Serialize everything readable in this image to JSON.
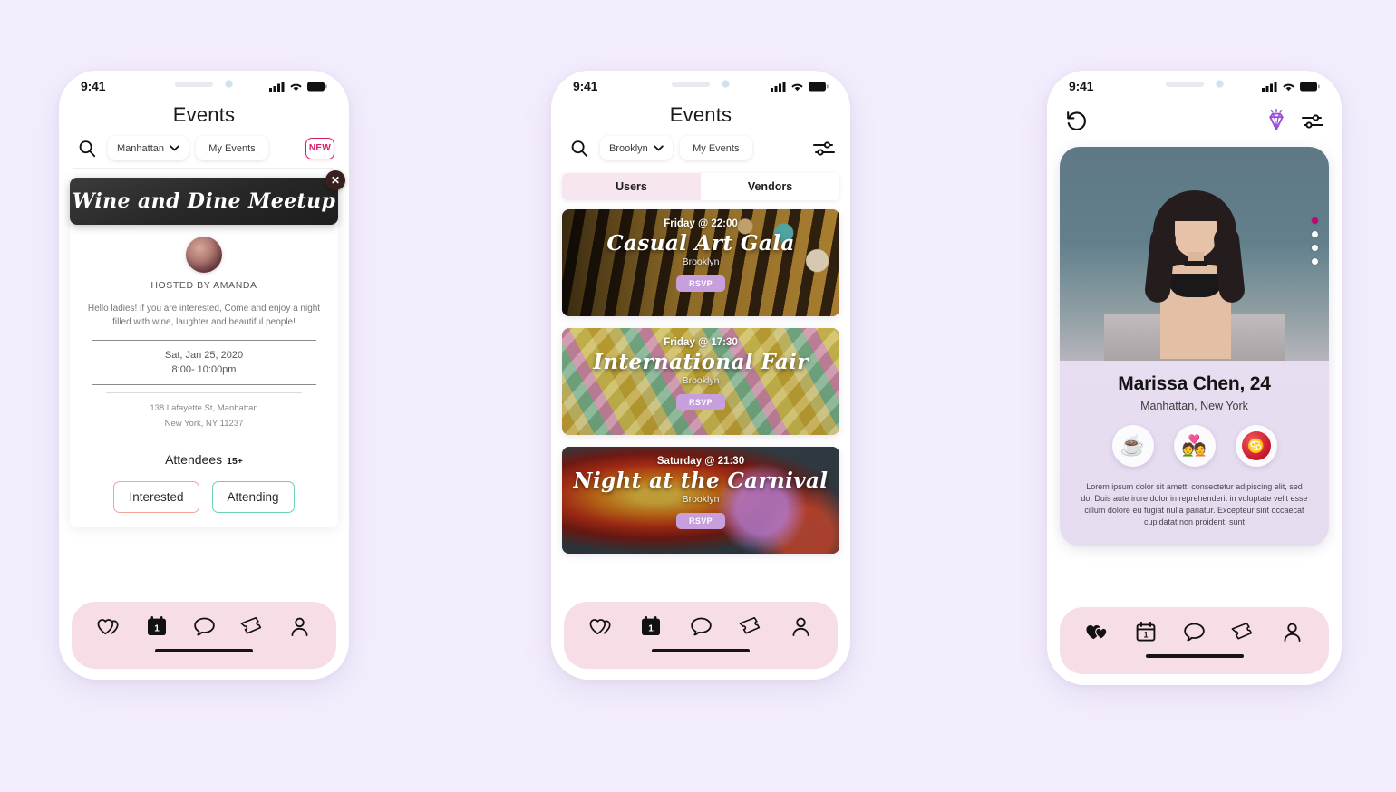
{
  "background_color": "#f3edfd",
  "accent": {
    "pink": "#d61f69",
    "nav_bg": "#f7dde5",
    "tab_active_bg": "#f7e6ef",
    "rsvp_bg": "#c79fdc",
    "gem_purple": "#9b4dd8",
    "dot_active": "#c4046b"
  },
  "phone1": {
    "status": {
      "time": "9:41",
      "cellular": "signal-bars-icon",
      "wifi": "wifi-icon",
      "battery": "battery-icon"
    },
    "title": "Events",
    "toolbar": {
      "search_icon": "search-icon",
      "location": "Manhattan",
      "location_chevron": "chevron-down-icon",
      "my_events": "My Events",
      "new_badge": "NEW"
    },
    "event": {
      "banner_title": "Wine and Dine Meetup",
      "close_icon": "close-icon",
      "avatar": "host-avatar",
      "host": "HOSTED BY AMANDA",
      "description": "Hello ladies! if you are interested, Come and enjoy a night filled with wine, laughter  and beautiful people!",
      "date": "Sat, Jan 25, 2020",
      "time": "8:00- 10:00pm",
      "address_line1": "138 Lafayette St, Manhattan",
      "address_line2": "New York, NY 11237",
      "attendees_label": "Attendees",
      "attendees_count": "15+",
      "btn_interested": "Interested",
      "btn_attending": "Attending"
    },
    "nav": [
      {
        "name": "hearts",
        "icon": "two-hearts-icon",
        "active": false
      },
      {
        "name": "calendar",
        "icon": "calendar-icon",
        "active": true,
        "badge": "1"
      },
      {
        "name": "chat",
        "icon": "chat-bubble-icon",
        "active": false
      },
      {
        "name": "tickets",
        "icon": "ticket-icon",
        "active": false
      },
      {
        "name": "profile",
        "icon": "person-icon",
        "active": false
      }
    ]
  },
  "phone2": {
    "status": {
      "time": "9:41"
    },
    "title": "Events",
    "toolbar": {
      "search_icon": "search-icon",
      "location": "Brooklyn",
      "location_chevron": "chevron-down-icon",
      "my_events": "My Events",
      "filter_icon": "sliders-icon"
    },
    "tabs": [
      {
        "label": "Users",
        "active": true
      },
      {
        "label": "Vendors",
        "active": false
      }
    ],
    "events": [
      {
        "time": "Friday @ 22:00",
        "title": "Casual Art Gala",
        "location": "Brooklyn",
        "rsvp": "RSVP",
        "bg": "bg-art"
      },
      {
        "time": "Friday @ 17:30",
        "title": "International Fair",
        "location": "Brooklyn",
        "rsvp": "RSVP",
        "bg": "bg-fair"
      },
      {
        "time": "Saturday @ 21:30",
        "title": "Night at the Carnival",
        "location": "Brooklyn",
        "rsvp": "RSVP",
        "bg": "bg-carn"
      }
    ],
    "nav": [
      {
        "name": "hearts",
        "icon": "two-hearts-icon",
        "active": false
      },
      {
        "name": "calendar",
        "icon": "calendar-icon",
        "active": true,
        "badge": "1"
      },
      {
        "name": "chat",
        "icon": "chat-bubble-icon",
        "active": false
      },
      {
        "name": "tickets",
        "icon": "ticket-icon",
        "active": false
      },
      {
        "name": "profile",
        "icon": "person-icon",
        "active": false
      }
    ]
  },
  "phone3": {
    "status": {
      "time": "9:41"
    },
    "header": {
      "rewind_icon": "rewind-icon",
      "gem_icon": "diamond-icon",
      "filter_icon": "sliders-icon"
    },
    "profile": {
      "photo": "profile-photo",
      "photo_dots": 4,
      "active_dot": 0,
      "name": "Marissa Chen,",
      "age": "24",
      "location": "Manhattan, New York",
      "interests": [
        {
          "name": "coffee",
          "glyph": "☕"
        },
        {
          "name": "couple",
          "glyph": "💑"
        },
        {
          "name": "zodiac-cancer",
          "glyph": "♋"
        }
      ],
      "bio": "Lorem ipsum dolor sit amett, consectetur adipiscing elit, sed do, Duis aute irure dolor in reprehenderit in voluptate velit esse cillum dolore eu fugiat nulla pariatur. Excepteur sint occaecat cupidatat non proident, sunt"
    },
    "nav": [
      {
        "name": "hearts",
        "icon": "two-hearts-icon",
        "active": true
      },
      {
        "name": "calendar",
        "icon": "calendar-icon",
        "active": false,
        "badge": "1"
      },
      {
        "name": "chat",
        "icon": "chat-bubble-icon",
        "active": false
      },
      {
        "name": "tickets",
        "icon": "ticket-icon",
        "active": false
      },
      {
        "name": "profile",
        "icon": "person-icon",
        "active": false
      }
    ]
  }
}
